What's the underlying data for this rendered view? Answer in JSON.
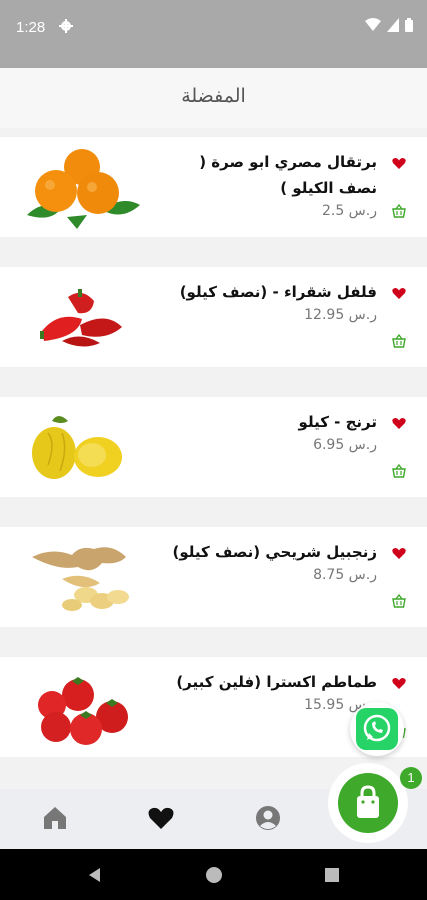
{
  "status": {
    "time": "1:28"
  },
  "header": {
    "title": "المفضلة"
  },
  "favorites": [
    {
      "name": "برتقال مصري ابو صرة ( نصف الكيلو )",
      "price": "ر.س 2.5",
      "image": "oranges"
    },
    {
      "name": "فلفل شقراء - (نصف كيلو)",
      "price": "ر.س 12.95",
      "image": "red-peppers"
    },
    {
      "name": "ترنج - كيلو",
      "price": "ر.س 6.95",
      "image": "citron"
    },
    {
      "name": "زنجبيل شريحي (نصف كيلو)",
      "price": "ر.س 8.75",
      "image": "ginger"
    },
    {
      "name": "طماطم اكسترا (فلين كبير)",
      "price": "ر.س 15.95",
      "image": "tomatoes"
    }
  ],
  "cart": {
    "count": "1"
  },
  "colors": {
    "accent": "#3fa92b",
    "favorite": "#d0021b",
    "status_bar": "#a9a9a9",
    "whatsapp": "#25d366"
  },
  "icons": {
    "status": [
      "gear-icon",
      "wifi-icon",
      "signal-icon",
      "battery-icon"
    ],
    "bottom_nav": [
      "home-icon",
      "heart-icon",
      "account-icon",
      "shopping-bag-icon"
    ],
    "system_nav": [
      "back-icon",
      "home-circle-icon",
      "recents-icon"
    ]
  }
}
